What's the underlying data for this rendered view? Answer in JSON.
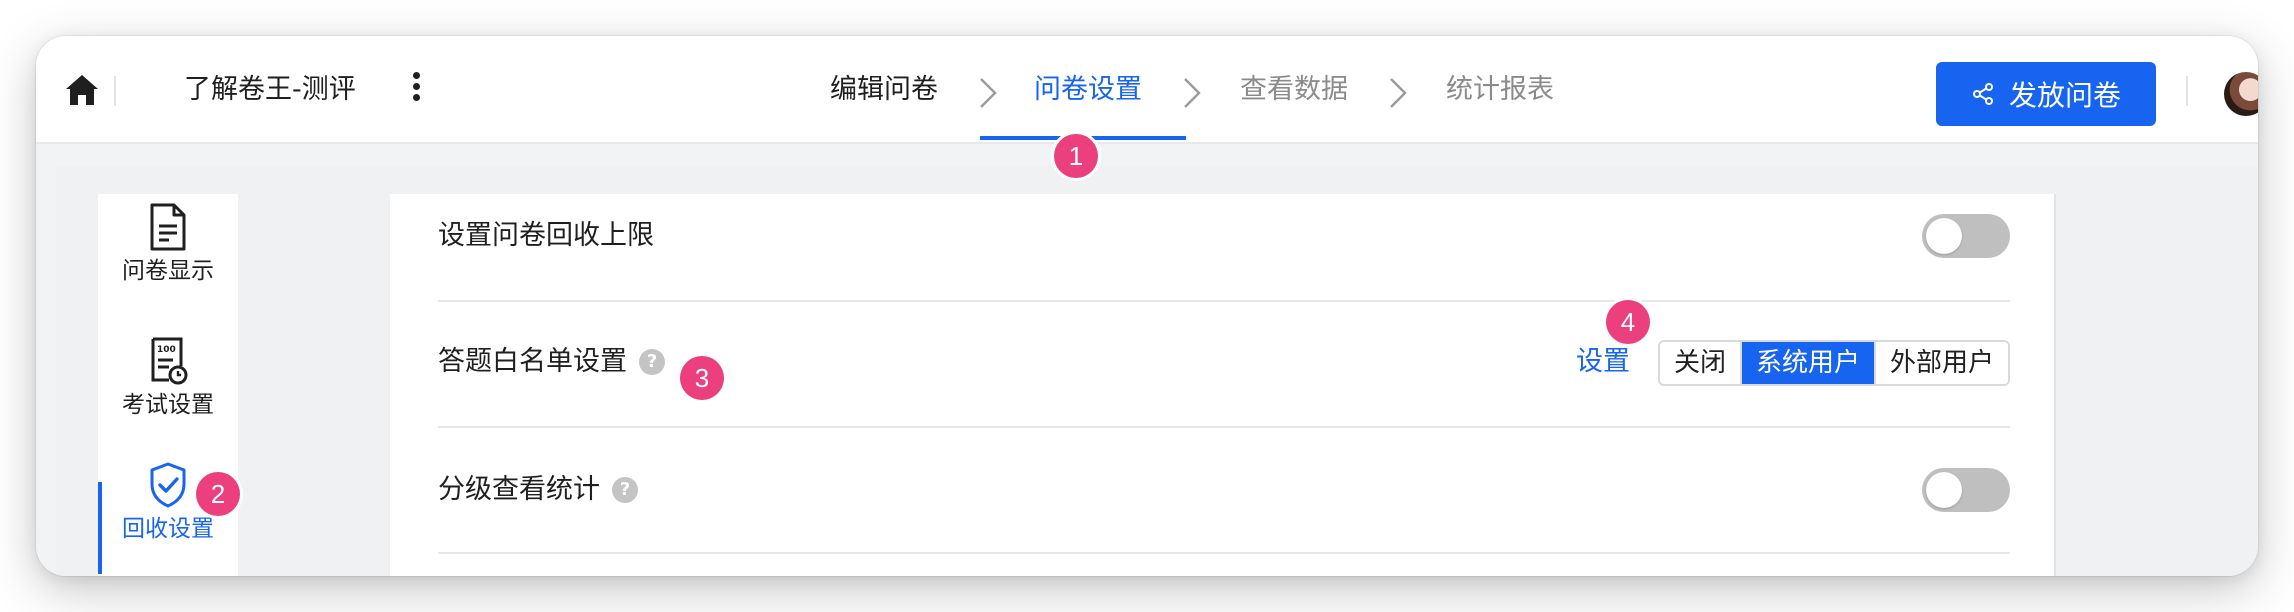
{
  "header": {
    "project_title": "了解卷王-测评",
    "steps": [
      {
        "label": "编辑问卷",
        "state": "done"
      },
      {
        "label": "问卷设置",
        "state": "active"
      },
      {
        "label": "查看数据",
        "state": "pending"
      },
      {
        "label": "统计报表",
        "state": "pending"
      }
    ],
    "publish_label": "发放问卷"
  },
  "sidebar": {
    "items": [
      {
        "label": "问卷显示",
        "icon": "document-icon"
      },
      {
        "label": "考试设置",
        "icon": "exam-score-icon"
      },
      {
        "label": "回收设置",
        "icon": "shield-check-icon",
        "active": true
      }
    ]
  },
  "settings": {
    "rows": [
      {
        "label": "设置问卷回收上限",
        "control": "toggle",
        "on": false
      },
      {
        "label": "答题白名单设置",
        "help": "?",
        "control": "segmented",
        "link": "设置",
        "options": [
          "关闭",
          "系统用户",
          "外部用户"
        ],
        "selected": "系统用户"
      },
      {
        "label": "分级查看统计",
        "help": "?",
        "control": "toggle",
        "on": false
      }
    ]
  },
  "markers": [
    "1",
    "2",
    "3",
    "4"
  ],
  "colors": {
    "accent": "#1664f0",
    "marker": "#eb3f7e",
    "toggle_off": "#bfbfbf"
  }
}
